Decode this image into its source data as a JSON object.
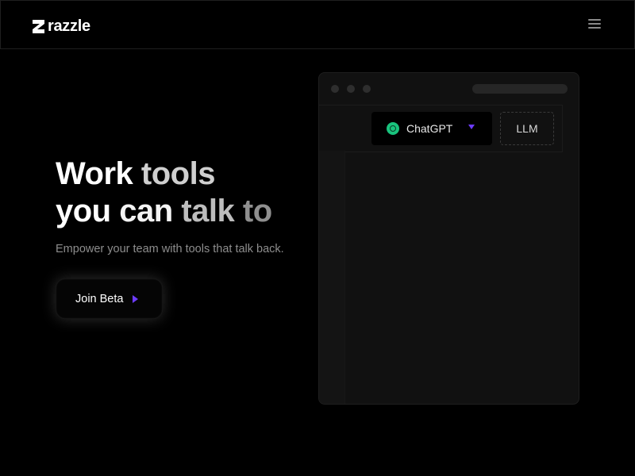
{
  "header": {
    "logo_text": "razzle",
    "menu_icon": "hamburger-menu-icon"
  },
  "hero": {
    "title_line1": [
      "Work",
      "tools"
    ],
    "title_line2": [
      "you",
      "can",
      "talk",
      "to"
    ],
    "subtitle": "Empower your team with tools that talk back.",
    "cta_label": "Join Beta",
    "cta_arrow_color": "#6d3bff"
  },
  "preview": {
    "model_select": {
      "selected": "ChatGPT",
      "icon": "chatgpt-icon",
      "icon_color": "#19c37d",
      "caret_color": "#6d3bff"
    },
    "tag_label": "LLM"
  }
}
